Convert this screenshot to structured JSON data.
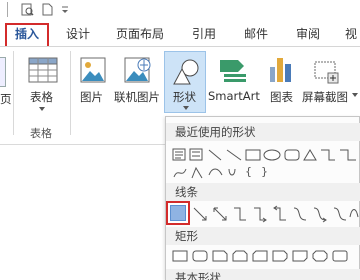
{
  "colors": {
    "accent_blue": "#2b579a",
    "highlight_red": "#d32b2b",
    "selected_button_bg": "#cde3f7"
  },
  "tabs": [
    {
      "label": "插入"
    },
    {
      "label": "设计"
    },
    {
      "label": "页面布局"
    },
    {
      "label": "引用"
    },
    {
      "label": "邮件"
    },
    {
      "label": "审阅"
    },
    {
      "label": "视"
    }
  ],
  "ribbon": {
    "left_edge_label": "页",
    "table_label": "表格",
    "table_group_label": "表格",
    "picture_label": "图片",
    "online_picture_label": "联机图片",
    "shapes_label": "形状",
    "smartart_label": "SmartArt",
    "chart_label": "图表",
    "screenshot_label": "屏幕截图"
  },
  "dropdown": {
    "recent_header": "最近使用的形状",
    "lines_header": "线条",
    "rectangles_header": "矩形",
    "basic_header": "基本形状",
    "recent_text_glyphs": [
      "{",
      "}"
    ]
  }
}
